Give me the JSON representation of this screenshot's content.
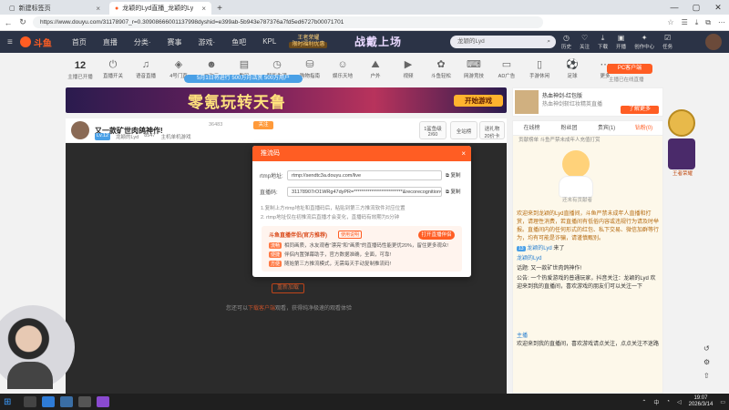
{
  "browser": {
    "tabs": [
      {
        "title": "新建标签页"
      },
      {
        "title": "龙颖的Lyd直播_龙颖的Lyd直播_龙颖..."
      }
    ],
    "url": "https://www.douyu.com/31178907_r=0.30908666001137998dyshid=e399ab-5b943e787376a7fd5ed6727b00071701"
  },
  "site": {
    "logo": "斗鱼",
    "nav": [
      "首页",
      "直播",
      "分类·",
      "赛事",
      "游戏·",
      "鱼吧",
      "KPL"
    ],
    "kpl_badge": {
      "line1": "王者荣耀",
      "line2": "限时福利优惠"
    },
    "banner_art": "战戴上场",
    "search_placeholder": "龙颖的Lyd",
    "user_icons": [
      "历史",
      "关注",
      "下载",
      "开播",
      "创作中心",
      "任务"
    ]
  },
  "categories": {
    "follow_count": "12",
    "follow_label": "主播已开播",
    "items": [
      "直播开关",
      "语音直播",
      "4号门直",
      "二次元",
      "数码",
      "智能生活",
      "购物指南",
      "娱乐天地",
      "户外",
      "视频",
      "斗鱼轻松",
      "网游竞技",
      "AD广告",
      "手游休闲",
      "足球",
      "更多"
    ],
    "notice": "5月1日将进行 500万月活赏 500万用户",
    "pc_client": "PC客户端",
    "pc_client_sub": "主播已在线直播"
  },
  "ad": {
    "title": "零氪玩转天鲁",
    "button": "开始游戏"
  },
  "side_ad": {
    "title": "热血神剑-红包版",
    "sub": "热血神剑斩红妆精英直播",
    "button": "了解更多"
  },
  "room": {
    "title": "又一款矿世肉鸽神作!",
    "heat": "36483",
    "follow": "关注",
    "level": "Lv.12",
    "host": "龙颖的Lyd",
    "fans": "8547",
    "category": "主机单机游戏",
    "stats": [
      {
        "label": "1鲨鱼级",
        "value": "2/60"
      },
      {
        "label": "全站榜",
        "value": ""
      },
      {
        "label": "送礼物",
        "value": "20价卡"
      }
    ]
  },
  "player": {
    "manual_button": "重新加载",
    "msg_prefix": "您还可以",
    "msg_link": "下载客户端",
    "msg_suffix": "观看，获得纯净极速的观看体验"
  },
  "modal": {
    "title": "推流码",
    "rtmp_label": "rtmp地址:",
    "rtmp_value": "rtmp://sendtc3a.douyu.com/live",
    "code_label": "直播码:",
    "code_value": "31178907rO1WRg47dyPR=*************************&recorecognition=",
    "copy": "复制",
    "tips": [
      "1.复制上方rtmp地址和直播码后，粘贴到第三方推流软件对应位置",
      "2. rtmp地址仅在初推流后直播才会变化，直播码有效期为5分钟"
    ],
    "promo": {
      "title": "斗鱼直播伴侣(官方推荐)",
      "tag": "使用说明",
      "button": "打开直播伴侣",
      "lines": [
        {
          "tag": "流畅",
          "text": "相同画质，水友观看\"漂亮\"和\"画质\"的直播码性能更优20%，留住更多观众!"
        },
        {
          "tag": "便捷",
          "text": "伴侣内置弹幕助手，官方数据准确，全面，可靠!"
        },
        {
          "tag": "方便",
          "text": "随始第三方推流模式，无需每天手动复制推流码!"
        }
      ]
    }
  },
  "chat": {
    "tabs": [
      "在线榜",
      "粉丝团",
      "贵宾(1)",
      "钻粉(0)"
    ],
    "rank_strip": "贡献榜单     斗鱼严禁未成年人充值打赏",
    "mascot_caption": "还未有贡献者",
    "lines": [
      "欢迎来到龙颖的Lyd直播间，斗鱼严禁未成年人直播和打赏，请理性消费，若直播间有低俗内容或违规行为请及时举报。直播间内的任何形式的红包、私下交易、微信加群等行为，均有可能是诈骗，请谨慎甄别。"
    ],
    "entry": {
      "level": "13",
      "name": "龙颖的Lyd",
      "text": "来了"
    },
    "bullets": [
      {
        "name": "龙颖的Lyd",
        "text": ""
      },
      {
        "name": "话题",
        "text": "又一款矿世肉鸽神作!"
      },
      {
        "name": "公告",
        "text": "一个热爱游戏的普通玩家，抖音关注：龙颖的Lyd"
      }
    ],
    "announcement_extra": "欢迎来到我的直播间，喜欢游戏的朋友们可以关注一下",
    "input_name": "主播",
    "input_text": "欢迎来到我的直播间，喜欢游戏请点关注，点点关注不迷路"
  },
  "side_badge_text": "王者荣耀",
  "taskbar": {
    "time": "19:07",
    "date": "2026/3/14",
    "lang": "中"
  }
}
